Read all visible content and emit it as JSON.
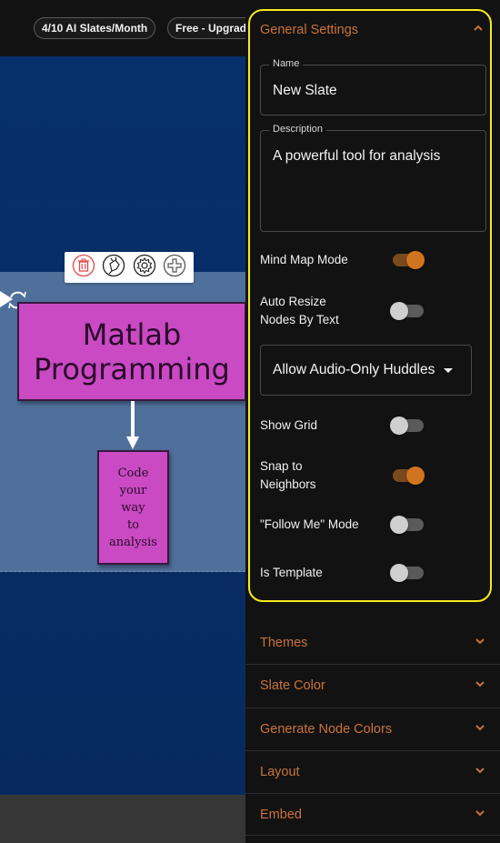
{
  "topbar": {
    "ai_slates_badge": "4/10 AI Slates/Month",
    "plan_badge": "Free - Upgrade"
  },
  "canvas": {
    "toolbar": {
      "icons": [
        "trash-icon",
        "plug-icon",
        "gear-icon",
        "plus-icon"
      ]
    },
    "main_node": {
      "text": "Matlab Programming",
      "color": "#c94ac3"
    },
    "child_node": {
      "lines": [
        "Code",
        "your",
        "way",
        "to",
        "analysis"
      ],
      "color": "#c94ac3"
    },
    "background_color": "#082c66"
  },
  "panel": {
    "general_settings": {
      "title": "General Settings",
      "expanded": true,
      "name_field": {
        "label": "Name",
        "value": "New Slate"
      },
      "description_field": {
        "label": "Description",
        "value": "A powerful tool for analysis"
      },
      "toggles": [
        {
          "label": "Mind Map Mode",
          "on": true
        },
        {
          "label": "Auto Resize Nodes By Text",
          "on": false
        }
      ],
      "huddle_select": {
        "value": "Allow Audio-Only Huddles"
      },
      "toggles_2": [
        {
          "label": "Show Grid",
          "on": false
        },
        {
          "label": "Snap to Neighbors",
          "on": true
        },
        {
          "label": "\"Follow Me\" Mode",
          "on": false
        },
        {
          "label": "Is Template",
          "on": false
        }
      ]
    },
    "sections": [
      {
        "title": "Themes"
      },
      {
        "title": "Slate Color"
      },
      {
        "title": "Generate Node Colors"
      },
      {
        "title": "Layout"
      },
      {
        "title": "Embed"
      }
    ],
    "accent_color": "#c9733a",
    "highlight_color": "#f5ec1a"
  }
}
